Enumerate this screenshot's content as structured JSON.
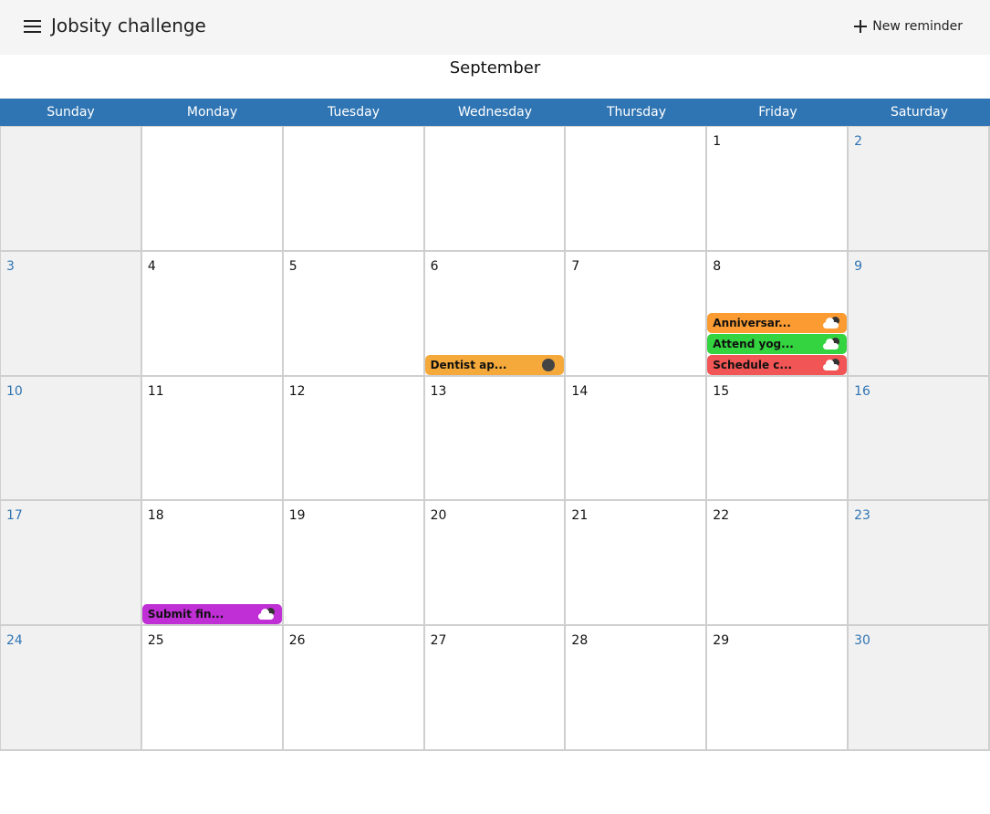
{
  "app": {
    "title": "Jobsity challenge",
    "new_reminder_label": "New reminder"
  },
  "calendar": {
    "month": "September",
    "weekdays": [
      "Sunday",
      "Monday",
      "Tuesday",
      "Wednesday",
      "Thursday",
      "Friday",
      "Saturday"
    ],
    "days": [
      "",
      "",
      "",
      "",
      "",
      "1",
      "2",
      "3",
      "4",
      "5",
      "6",
      "7",
      "8",
      "9",
      "10",
      "11",
      "12",
      "13",
      "14",
      "15",
      "16",
      "17",
      "18",
      "19",
      "20",
      "21",
      "22",
      "23",
      "24",
      "25",
      "26",
      "27",
      "28",
      "29",
      "30"
    ],
    "reminders": [
      {
        "day": "6",
        "text": "Dentist ap...",
        "color": "#f4a93a",
        "weather_icon": "moon-icon"
      },
      {
        "day": "8",
        "text": "Anniversar...",
        "color": "#fb9b32",
        "weather_icon": "partly-cloudy-icon"
      },
      {
        "day": "8",
        "text": "Attend yog...",
        "color": "#33d43f",
        "weather_icon": "partly-cloudy-icon"
      },
      {
        "day": "8",
        "text": "Schedule c...",
        "color": "#f25555",
        "weather_icon": "partly-cloudy-icon"
      },
      {
        "day": "18",
        "text": "Submit fin...",
        "color": "#c02fd6",
        "weather_icon": "partly-cloudy-icon"
      }
    ]
  },
  "colors": {
    "header_bg": "#3075b3",
    "weekend_text": "#3075b3",
    "appbar_bg": "#f5f5f5",
    "weekend_bg": "#f1f1f1"
  }
}
